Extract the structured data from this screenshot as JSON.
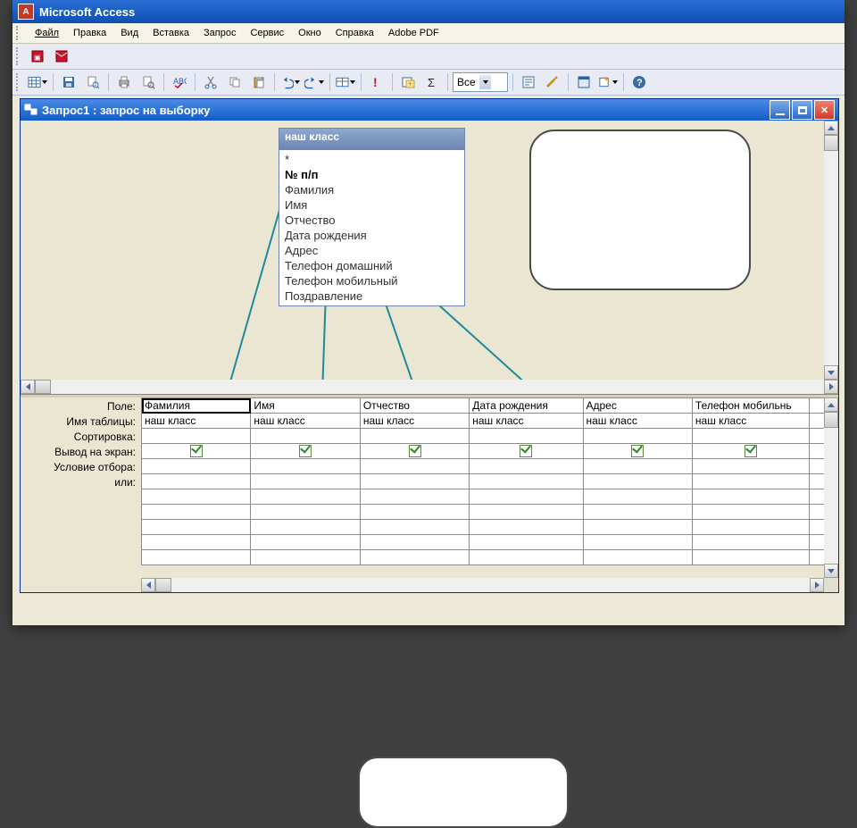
{
  "app": {
    "title": "Microsoft Access"
  },
  "menu": {
    "file": "Файл",
    "edit": "Правка",
    "view": "Вид",
    "insert": "Вставка",
    "query": "Запрос",
    "tools": "Сервис",
    "window": "Окно",
    "help": "Справка",
    "adobepdf": "Adobe PDF"
  },
  "toolbar": {
    "combo_value": "Все"
  },
  "child": {
    "title": "Запрос1 : запрос на выборку"
  },
  "field_list": {
    "title": "наш класс",
    "items": [
      "*",
      "№ п/п",
      "Фамилия",
      "Имя",
      "Отчество",
      "Дата рождения",
      "Адрес",
      "Телефон домашний",
      "Телефон мобильный",
      "Поздравление"
    ],
    "pk_index": 1
  },
  "qbe": {
    "labels": {
      "field": "Поле:",
      "table": "Имя таблицы:",
      "sort": "Сортировка:",
      "show": "Вывод на экран:",
      "criteria": "Условие отбора:",
      "or": "или:"
    },
    "columns": [
      {
        "field": "Фамилия",
        "table": "наш класс",
        "sort": "",
        "show": true,
        "criteria": "",
        "or": ""
      },
      {
        "field": "Имя",
        "table": "наш класс",
        "sort": "",
        "show": true,
        "criteria": "",
        "or": ""
      },
      {
        "field": "Отчество",
        "table": "наш класс",
        "sort": "",
        "show": true,
        "criteria": "",
        "or": ""
      },
      {
        "field": "Дата рождения",
        "table": "наш класс",
        "sort": "",
        "show": true,
        "criteria": "",
        "or": ""
      },
      {
        "field": "Адрес",
        "table": "наш класс",
        "sort": "",
        "show": true,
        "criteria": "",
        "or": ""
      },
      {
        "field": "Телефон мобильнь",
        "table": "наш класс",
        "sort": "",
        "show": true,
        "criteria": "",
        "or": ""
      }
    ]
  }
}
